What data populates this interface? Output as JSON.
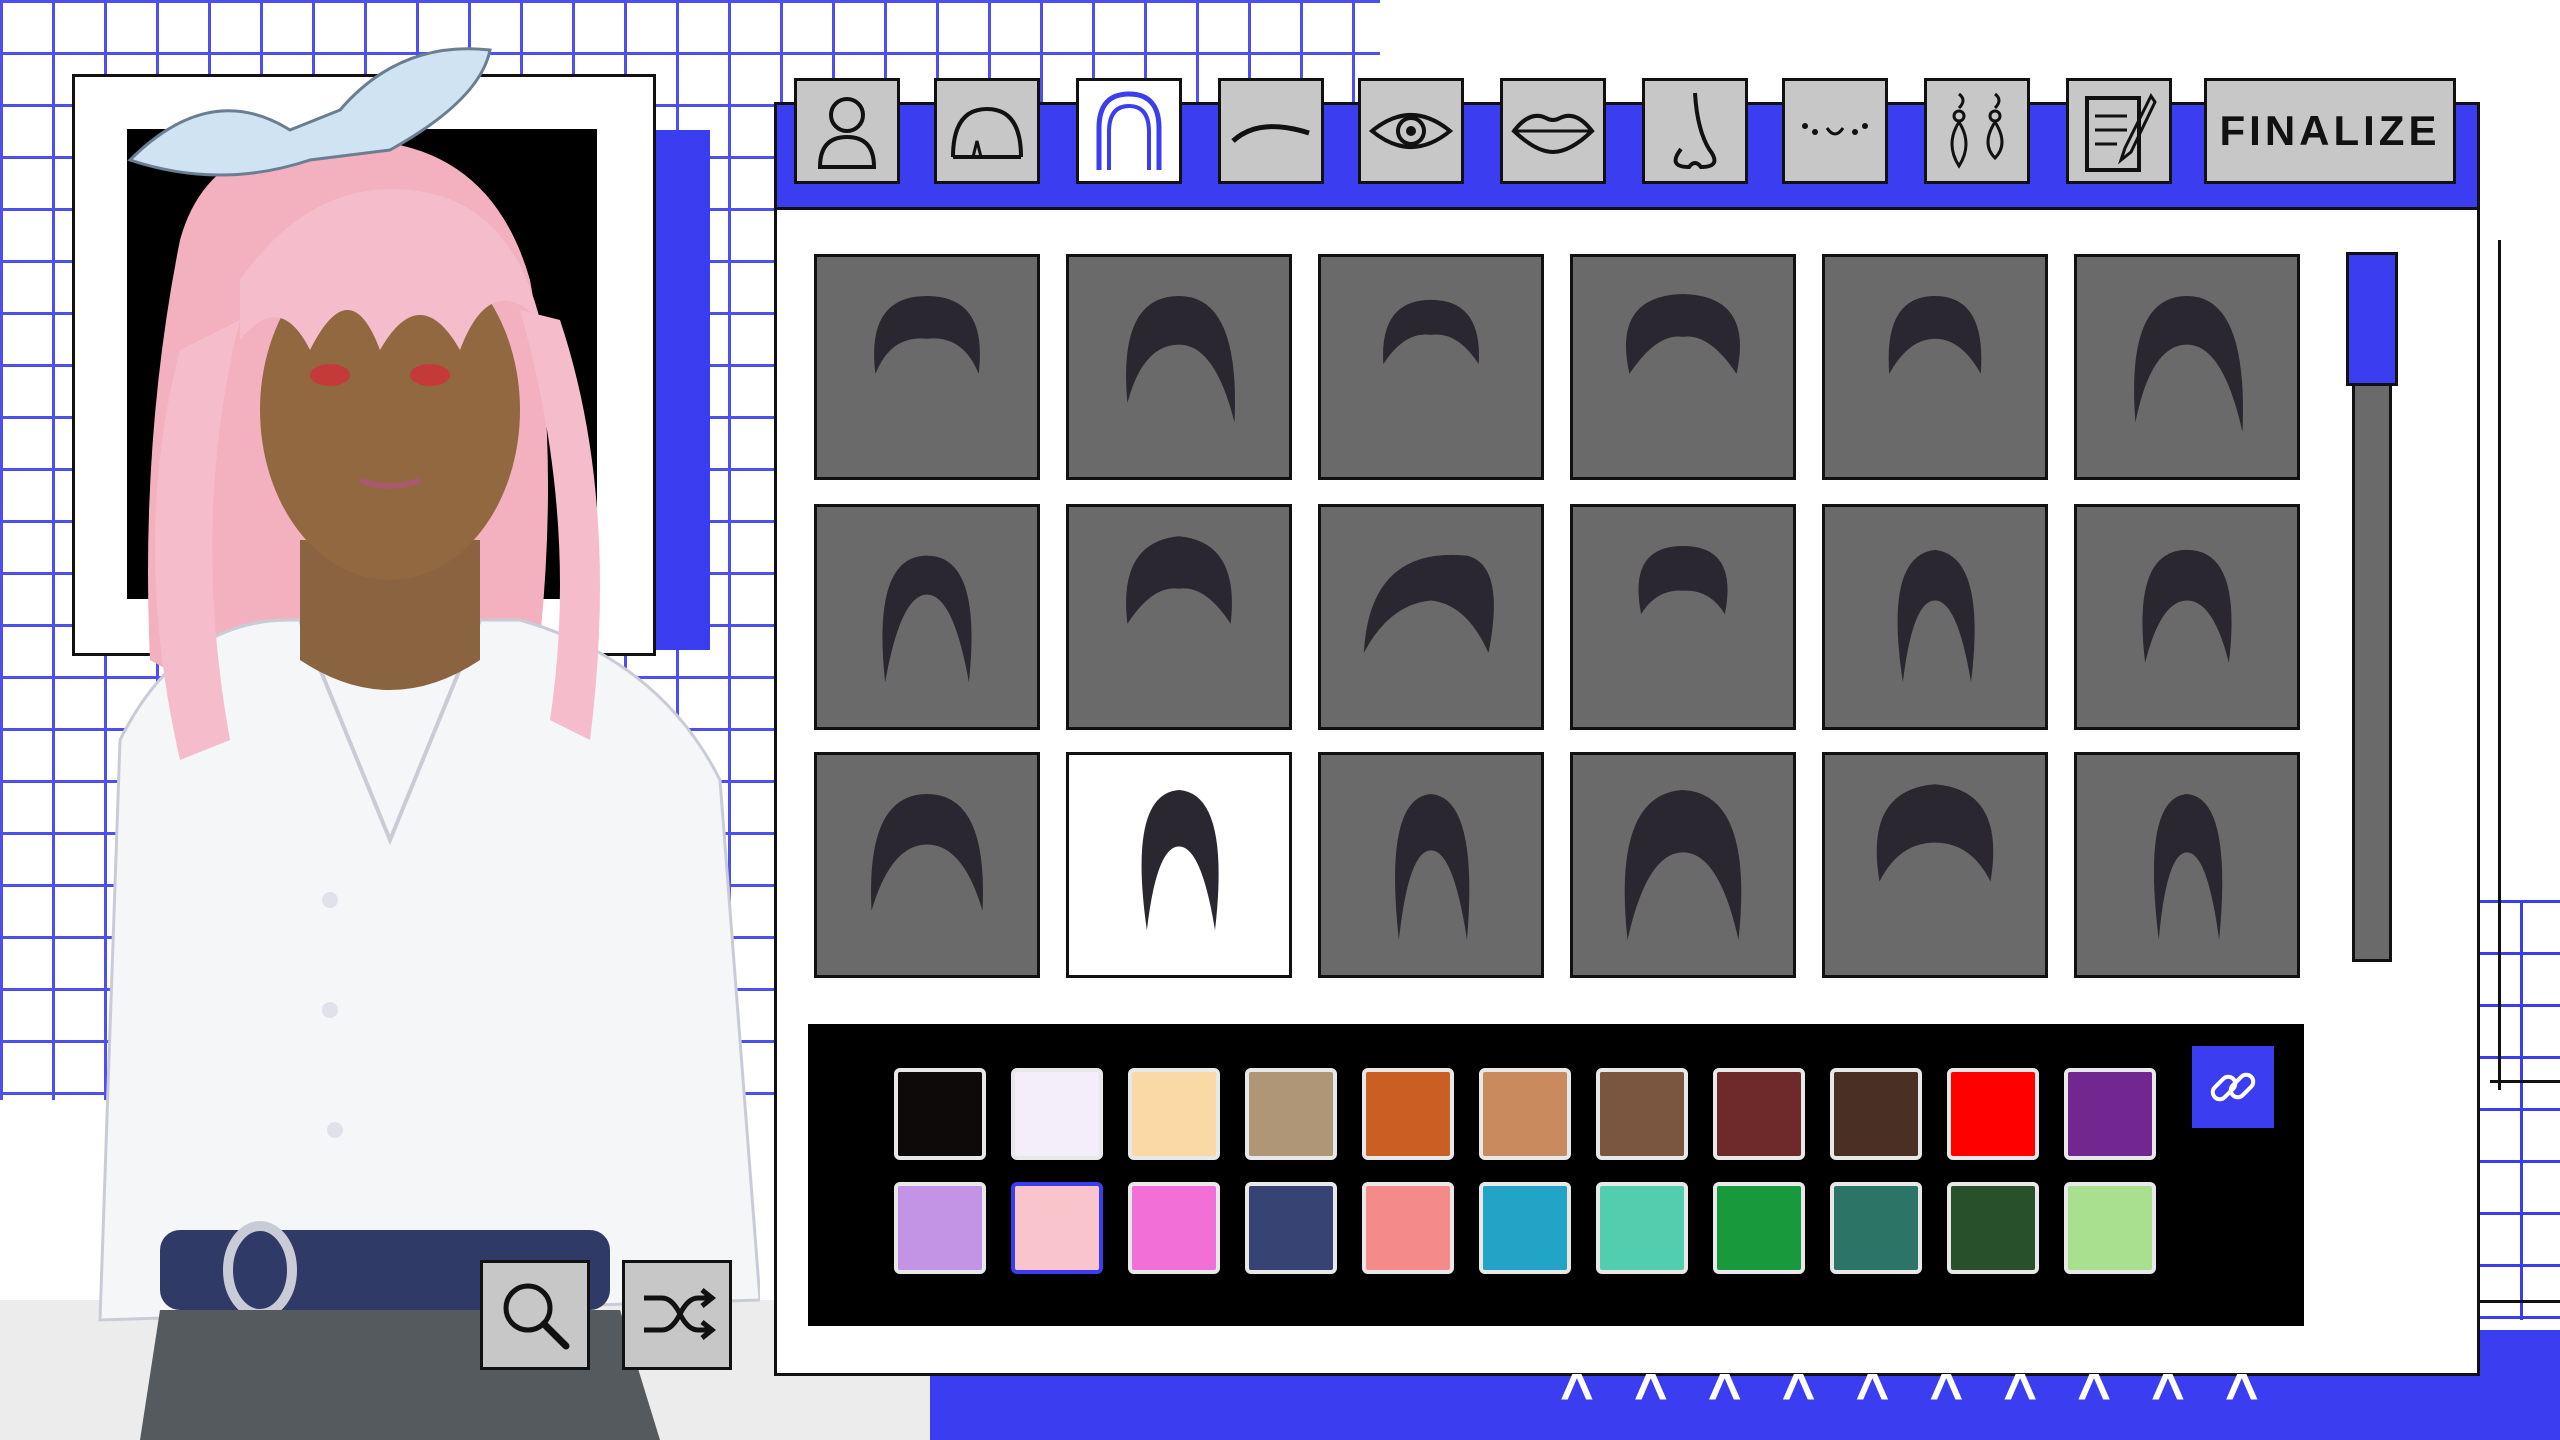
{
  "app": {
    "screen": "character-creator-hair"
  },
  "tabs": [
    {
      "id": "body",
      "icon": "person-icon"
    },
    {
      "id": "head-shape",
      "icon": "head-shape-icon"
    },
    {
      "id": "hair",
      "icon": "hair-icon",
      "active": true
    },
    {
      "id": "eyebrows",
      "icon": "eyebrow-icon"
    },
    {
      "id": "eyes",
      "icon": "eye-icon"
    },
    {
      "id": "lips",
      "icon": "lips-icon"
    },
    {
      "id": "nose",
      "icon": "nose-icon"
    },
    {
      "id": "facial-marks",
      "icon": "freckles-icon"
    },
    {
      "id": "accessories",
      "icon": "earrings-icon"
    },
    {
      "id": "notes",
      "icon": "notepad-icon"
    }
  ],
  "finalize_label": "FINALIZE",
  "hair_styles": [
    {
      "id": 1
    },
    {
      "id": 2
    },
    {
      "id": 3
    },
    {
      "id": 4
    },
    {
      "id": 5
    },
    {
      "id": 6
    },
    {
      "id": 7
    },
    {
      "id": 8
    },
    {
      "id": 9
    },
    {
      "id": 10
    },
    {
      "id": 11
    },
    {
      "id": 12
    },
    {
      "id": 13
    },
    {
      "id": 14,
      "selected": true
    },
    {
      "id": 15
    },
    {
      "id": 16
    },
    {
      "id": 17
    },
    {
      "id": 18
    }
  ],
  "palette": {
    "row1": [
      "#0e0a0a",
      "#f4eefa",
      "#fad9a6",
      "#ae9676",
      "#c95f22",
      "#c98a5e",
      "#7a5640",
      "#6e2a2a",
      "#4a3024",
      "#ff0000",
      "#722690"
    ],
    "row2": [
      "#c394e6",
      "#fac4cc",
      "#f26fd8",
      "#374473",
      "#f58a8a",
      "#21a4c6",
      "#52ceaf",
      "#189a3c",
      "#2c7566",
      "#27502b",
      "#a9e08f"
    ],
    "selected_row": 2,
    "selected_index": 1
  },
  "tools": [
    {
      "id": "zoom",
      "icon": "magnifier-icon"
    },
    {
      "id": "randomize",
      "icon": "shuffle-icon"
    }
  ],
  "link_icon": "link-icon",
  "colors": {
    "accent": "#3a3df0",
    "tile": "#6a6a6a",
    "button": "#c7c7c7"
  }
}
